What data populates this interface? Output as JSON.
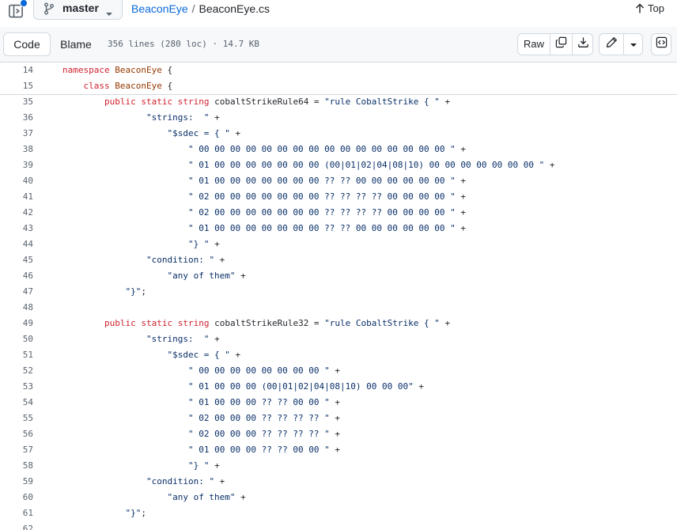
{
  "header": {
    "branch": "master",
    "repo": "BeaconEye",
    "separator": "/",
    "file": "BeaconEye.cs",
    "top_label": "Top"
  },
  "file_header": {
    "tabs": [
      {
        "label": "Code"
      },
      {
        "label": "Blame"
      }
    ],
    "info": "356 lines (280 loc) · 14.7 KB",
    "raw_label": "Raw"
  },
  "sticky_lines": [
    {
      "num": "14",
      "code": "namespace BeaconEye {"
    },
    {
      "num": "15",
      "code": "    class BeaconEye {"
    }
  ],
  "code_lines": [
    {
      "num": "35",
      "code": "        public static string cobaltStrikeRule64 = \"rule CobaltStrike { \" +"
    },
    {
      "num": "36",
      "code": "                \"strings:  \" +"
    },
    {
      "num": "37",
      "code": "                    \"$sdec = { \" +"
    },
    {
      "num": "38",
      "code": "                        \" 00 00 00 00 00 00 00 00 00 00 00 00 00 00 00 00 \" +"
    },
    {
      "num": "39",
      "code": "                        \" 01 00 00 00 00 00 00 00 (00|01|02|04|08|10) 00 00 00 00 00 00 00 \" +"
    },
    {
      "num": "40",
      "code": "                        \" 01 00 00 00 00 00 00 00 ?? ?? 00 00 00 00 00 00 \" +"
    },
    {
      "num": "41",
      "code": "                        \" 02 00 00 00 00 00 00 00 ?? ?? ?? ?? 00 00 00 00 \" +"
    },
    {
      "num": "42",
      "code": "                        \" 02 00 00 00 00 00 00 00 ?? ?? ?? ?? 00 00 00 00 \" +"
    },
    {
      "num": "43",
      "code": "                        \" 01 00 00 00 00 00 00 00 ?? ?? 00 00 00 00 00 00 \" +"
    },
    {
      "num": "44",
      "code": "                        \"} \" +"
    },
    {
      "num": "45",
      "code": "                \"condition: \" +"
    },
    {
      "num": "46",
      "code": "                    \"any of them\" +"
    },
    {
      "num": "47",
      "code": "            \"}\";"
    },
    {
      "num": "48",
      "code": ""
    },
    {
      "num": "49",
      "code": "        public static string cobaltStrikeRule32 = \"rule CobaltStrike { \" +"
    },
    {
      "num": "50",
      "code": "                \"strings:  \" +"
    },
    {
      "num": "51",
      "code": "                    \"$sdec = { \" +"
    },
    {
      "num": "52",
      "code": "                        \" 00 00 00 00 00 00 00 00 \" +"
    },
    {
      "num": "53",
      "code": "                        \" 01 00 00 00 (00|01|02|04|08|10) 00 00 00\" +"
    },
    {
      "num": "54",
      "code": "                        \" 01 00 00 00 ?? ?? 00 00 \" +"
    },
    {
      "num": "55",
      "code": "                        \" 02 00 00 00 ?? ?? ?? ?? \" +"
    },
    {
      "num": "56",
      "code": "                        \" 02 00 00 00 ?? ?? ?? ?? \" +"
    },
    {
      "num": "57",
      "code": "                        \" 01 00 00 00 ?? ?? 00 00 \" +"
    },
    {
      "num": "58",
      "code": "                        \"} \" +"
    },
    {
      "num": "59",
      "code": "                \"condition: \" +"
    },
    {
      "num": "60",
      "code": "                    \"any of them\" +"
    },
    {
      "num": "61",
      "code": "            \"}\";"
    },
    {
      "num": "62",
      "code": ""
    }
  ]
}
